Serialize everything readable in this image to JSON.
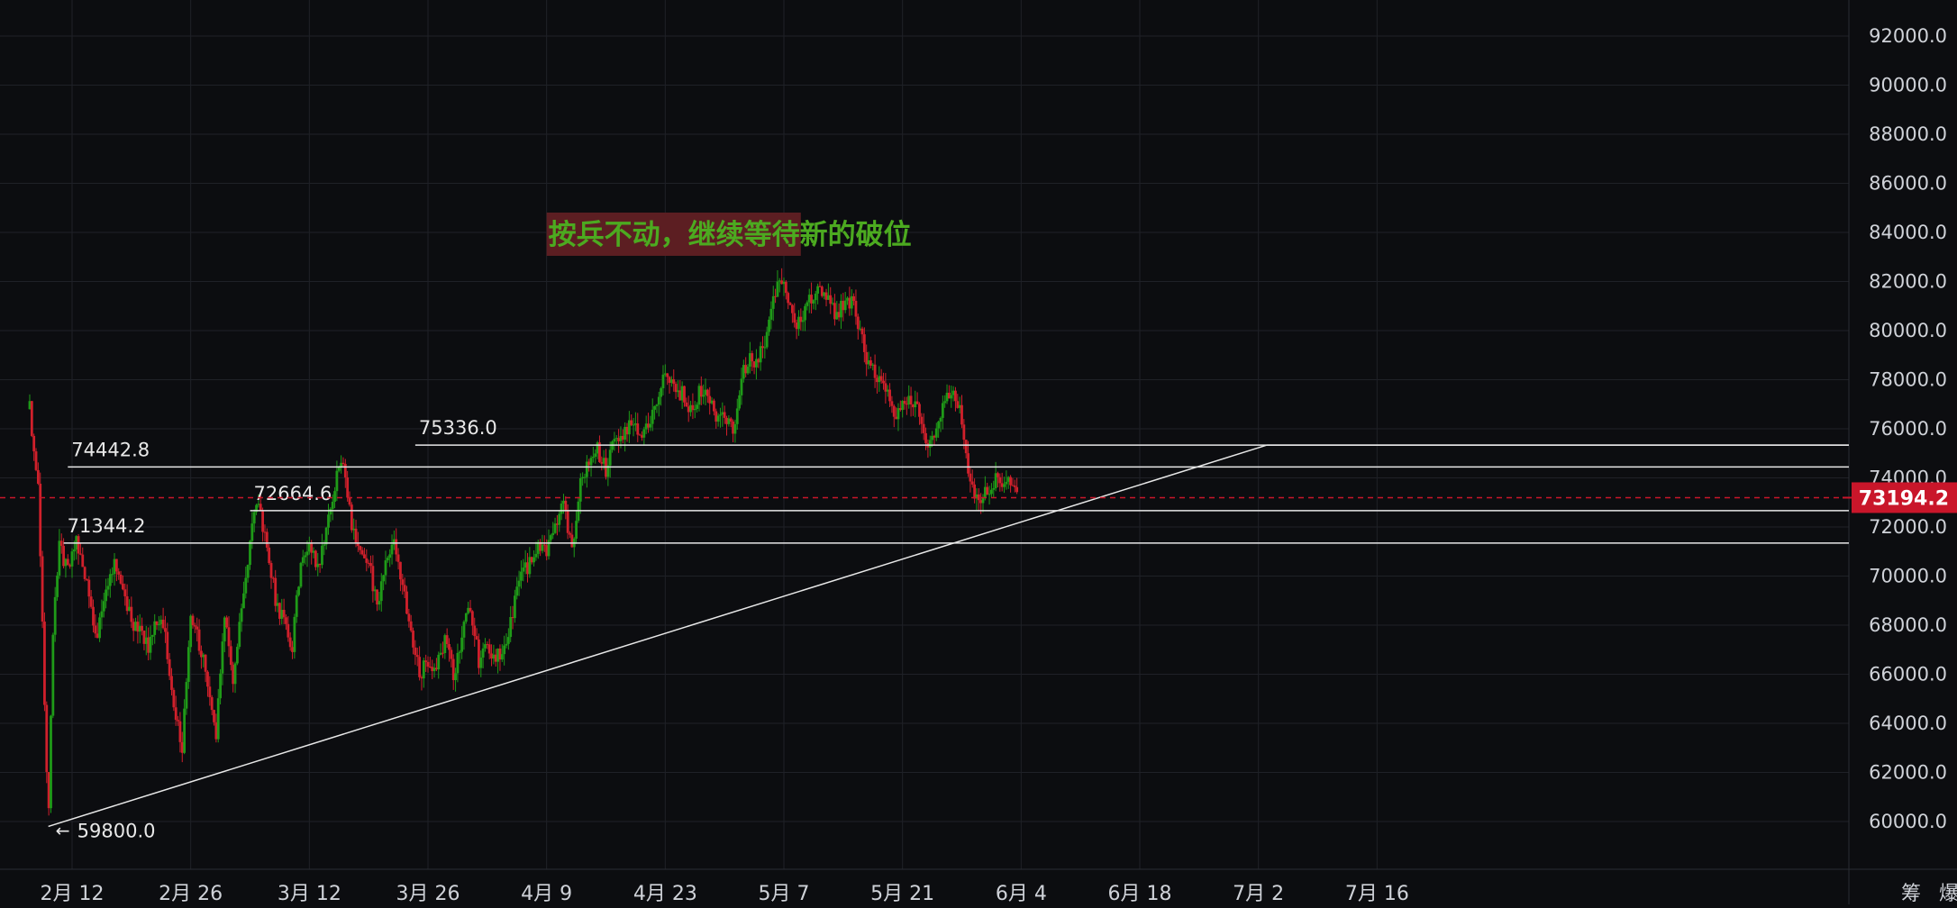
{
  "chart_data": {
    "type": "candlestick",
    "ylim": [
      57800,
      93000
    ],
    "y_ticks": [
      {
        "value": 92000,
        "label": "92000.0"
      },
      {
        "value": 90000,
        "label": "90000.0"
      },
      {
        "value": 88000,
        "label": "88000.0"
      },
      {
        "value": 86000,
        "label": "86000.0"
      },
      {
        "value": 84000,
        "label": "84000.0"
      },
      {
        "value": 82000,
        "label": "82000.0"
      },
      {
        "value": 80000,
        "label": "80000.0"
      },
      {
        "value": 78000,
        "label": "78000.0"
      },
      {
        "value": 76000,
        "label": "76000.0"
      },
      {
        "value": 74000,
        "label": "74000.0"
      },
      {
        "value": 72000,
        "label": "72000.0"
      },
      {
        "value": 70000,
        "label": "70000.0"
      },
      {
        "value": 68000,
        "label": "68000.0"
      },
      {
        "value": 66000,
        "label": "66000.0"
      },
      {
        "value": 64000,
        "label": "64000.0"
      },
      {
        "value": 62000,
        "label": "62000.0"
      },
      {
        "value": 60000,
        "label": "60000.0"
      }
    ],
    "x_ticks": [
      "2月 12",
      "2月 26",
      "3月 12",
      "3月 26",
      "4月 9",
      "4月 23",
      "5月 7",
      "5月 21",
      "6月 4",
      "6月 18",
      "7月 2",
      "7月 16"
    ],
    "x_tick_days": [
      0,
      14,
      28,
      42,
      56,
      70,
      84,
      98,
      112,
      126,
      140,
      154
    ],
    "x_domain_days": [
      -5,
      165
    ],
    "price_path": [
      [
        -5.0,
        76800
      ],
      [
        -4.0,
        73800
      ],
      [
        -3.5,
        68200
      ],
      [
        -3.0,
        61900
      ],
      [
        -2.8,
        59800
      ],
      [
        -2.2,
        68200
      ],
      [
        -1.5,
        71400
      ],
      [
        -0.5,
        70100
      ],
      [
        0.5,
        71600
      ],
      [
        1.5,
        70100
      ],
      [
        2.5,
        68300
      ],
      [
        3.0,
        67600
      ],
      [
        4.0,
        69600
      ],
      [
        5.0,
        70700
      ],
      [
        6.0,
        69400
      ],
      [
        7.0,
        68200
      ],
      [
        8.0,
        67800
      ],
      [
        9.0,
        67100
      ],
      [
        10.0,
        68300
      ],
      [
        11.0,
        67600
      ],
      [
        12.0,
        64600
      ],
      [
        13.0,
        62900
      ],
      [
        14.0,
        68400
      ],
      [
        15.0,
        67300
      ],
      [
        16.0,
        65700
      ],
      [
        17.0,
        63700
      ],
      [
        18.0,
        68600
      ],
      [
        19.0,
        65300
      ],
      [
        20.0,
        68900
      ],
      [
        21.0,
        71400
      ],
      [
        22.0,
        73200
      ],
      [
        23.0,
        71100
      ],
      [
        24.0,
        69100
      ],
      [
        25.0,
        68100
      ],
      [
        26.0,
        67200
      ],
      [
        27.0,
        70600
      ],
      [
        28.0,
        71500
      ],
      [
        29.0,
        70300
      ],
      [
        30.0,
        71700
      ],
      [
        31.0,
        73700
      ],
      [
        32.0,
        74700
      ],
      [
        33.0,
        72200
      ],
      [
        34.0,
        70900
      ],
      [
        35.0,
        70600
      ],
      [
        36.0,
        68800
      ],
      [
        37.0,
        70700
      ],
      [
        38.0,
        71300
      ],
      [
        39.0,
        69700
      ],
      [
        40.0,
        67700
      ],
      [
        41.0,
        66000
      ],
      [
        42.0,
        66600
      ],
      [
        43.0,
        66300
      ],
      [
        44.0,
        67500
      ],
      [
        45.0,
        65900
      ],
      [
        46.0,
        67600
      ],
      [
        47.0,
        68700
      ],
      [
        48.0,
        66600
      ],
      [
        49.0,
        67200
      ],
      [
        50.0,
        66700
      ],
      [
        51.0,
        67100
      ],
      [
        52.0,
        68600
      ],
      [
        53.0,
        69900
      ],
      [
        54.0,
        70600
      ],
      [
        55.0,
        71200
      ],
      [
        56.0,
        70900
      ],
      [
        57.0,
        72100
      ],
      [
        58.0,
        72900
      ],
      [
        59.0,
        70900
      ],
      [
        60.0,
        73700
      ],
      [
        61.0,
        74600
      ],
      [
        62.0,
        75200
      ],
      [
        63.0,
        74300
      ],
      [
        64.0,
        75900
      ],
      [
        65.0,
        75700
      ],
      [
        66.0,
        76300
      ],
      [
        67.0,
        75700
      ],
      [
        68.0,
        76100
      ],
      [
        69.0,
        77100
      ],
      [
        70.0,
        78500
      ],
      [
        71.0,
        77700
      ],
      [
        72.0,
        77400
      ],
      [
        73.0,
        76800
      ],
      [
        74.0,
        77500
      ],
      [
        75.0,
        77200
      ],
      [
        76.0,
        76400
      ],
      [
        77.0,
        76600
      ],
      [
        78.0,
        75900
      ],
      [
        79.0,
        78200
      ],
      [
        80.0,
        78800
      ],
      [
        81.0,
        78900
      ],
      [
        82.0,
        79600
      ],
      [
        83.0,
        81700
      ],
      [
        84.0,
        82300
      ],
      [
        85.0,
        80600
      ],
      [
        86.0,
        80100
      ],
      [
        87.0,
        81300
      ],
      [
        88.0,
        81600
      ],
      [
        89.0,
        81300
      ],
      [
        90.0,
        80800
      ],
      [
        91.0,
        80900
      ],
      [
        92.0,
        81200
      ],
      [
        93.0,
        79900
      ],
      [
        94.0,
        78600
      ],
      [
        95.0,
        78100
      ],
      [
        96.0,
        77600
      ],
      [
        97.0,
        76600
      ],
      [
        98.0,
        76900
      ],
      [
        99.0,
        77300
      ],
      [
        100.0,
        76600
      ],
      [
        101.0,
        75300
      ],
      [
        102.0,
        76000
      ],
      [
        103.0,
        77300
      ],
      [
        104.0,
        77600
      ],
      [
        105.0,
        76400
      ],
      [
        106.0,
        73800
      ],
      [
        107.0,
        72900
      ],
      [
        108.0,
        73500
      ],
      [
        109.0,
        73900
      ],
      [
        110.0,
        73900
      ],
      [
        111.0,
        73500
      ],
      [
        111.5,
        73194
      ]
    ],
    "horizontal_levels": [
      {
        "value": 75336.0,
        "label": "75336.0",
        "from_day": 40.5
      },
      {
        "value": 74442.8,
        "label": "74442.8",
        "from_day": -0.5
      },
      {
        "value": 72664.6,
        "label": "72664.6",
        "from_day": 21.0
      },
      {
        "value": 71344.2,
        "label": "71344.2",
        "from_day": -1.0
      }
    ],
    "trendline": {
      "from": [
        -2.8,
        59800.0
      ],
      "to": [
        141.0,
        75336.0
      ],
      "label": "59800.0"
    },
    "current_price": {
      "value": 73194.2,
      "label": "73194.2"
    },
    "annotation": {
      "text": "按兵不动，继续等待新的破位",
      "price": 84000,
      "from_day": 56.0,
      "to_day": 86.0
    },
    "scale_buttons": [
      "筹",
      "爆"
    ],
    "colors": {
      "background": "#0c0d10",
      "grid": "#1f2127",
      "up": "#1f9a18",
      "down": "#d0202b",
      "line": "#e8e8e8",
      "axis_text": "#cfd2d8",
      "price_tag": "#c9162a",
      "annotation_bg": "#5c1e22",
      "annotation_text": "#4caa20"
    }
  }
}
